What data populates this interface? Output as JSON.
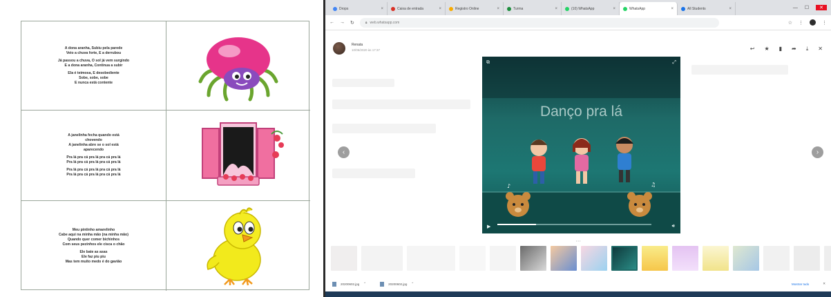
{
  "document": {
    "song1": {
      "stanzas": [
        [
          "A dona aranha, Subiu pela parede",
          "Veio a chuva forte, E a derrubou"
        ],
        [
          "Já passou a chuva, O sol já vem surgindo",
          "E a dona aranha, Continua a subir"
        ],
        [
          "Ela é teimosa, E desobediente",
          "Sobe, sobe, sobe",
          "E nunca está contente"
        ]
      ]
    },
    "song2": {
      "stanzas": [
        [
          "A janelinha fecha quando está",
          "chovendo",
          "A janelinha abre se o sol está",
          "aparecendo"
        ],
        [
          "Pra lá pra cá pra lá pra cá pra lá",
          "Pra lá pra cá pra lá pra cá pra lá"
        ],
        [
          "Pra lá pra cá pra lá pra cá pra lá",
          "Pra lá pra cá pra lá pra cá pra lá"
        ]
      ]
    },
    "song3": {
      "stanzas": [
        [
          "Meu pintinho amarelinho",
          "Cabe aqui na minha mão (na minha mão)",
          "Quando quer comer bichinhos",
          "Com seus pezinhos ele cisca o chão"
        ],
        [
          "Ele bate as asas",
          "Ele faz piu piu",
          "Mas tem muito medo é do gavião"
        ]
      ]
    }
  },
  "browser": {
    "tabs": [
      {
        "label": "Drops",
        "color": "#4285f4"
      },
      {
        "label": "Caixa de entrada",
        "color": "#d93025"
      },
      {
        "label": "Registro Online",
        "color": "#f9ab00"
      },
      {
        "label": "Turma",
        "color": "#1e8e3e"
      },
      {
        "label": "(10) WhatsApp",
        "color": "#25d366"
      },
      {
        "label": "WhatsApp",
        "color": "#25d366"
      },
      {
        "label": "All Students",
        "color": "#1a73e8"
      }
    ],
    "url": "web.whatsapp.com",
    "viewer": {
      "contact_name": "Renata",
      "timestamp": "10/06/2020 às 17:37",
      "video_title": "Danço pra lá"
    },
    "footer": {
      "file1": "20200602.jpg",
      "file2": "20200602.jpg",
      "show_all": "Mostrar tudo"
    }
  }
}
